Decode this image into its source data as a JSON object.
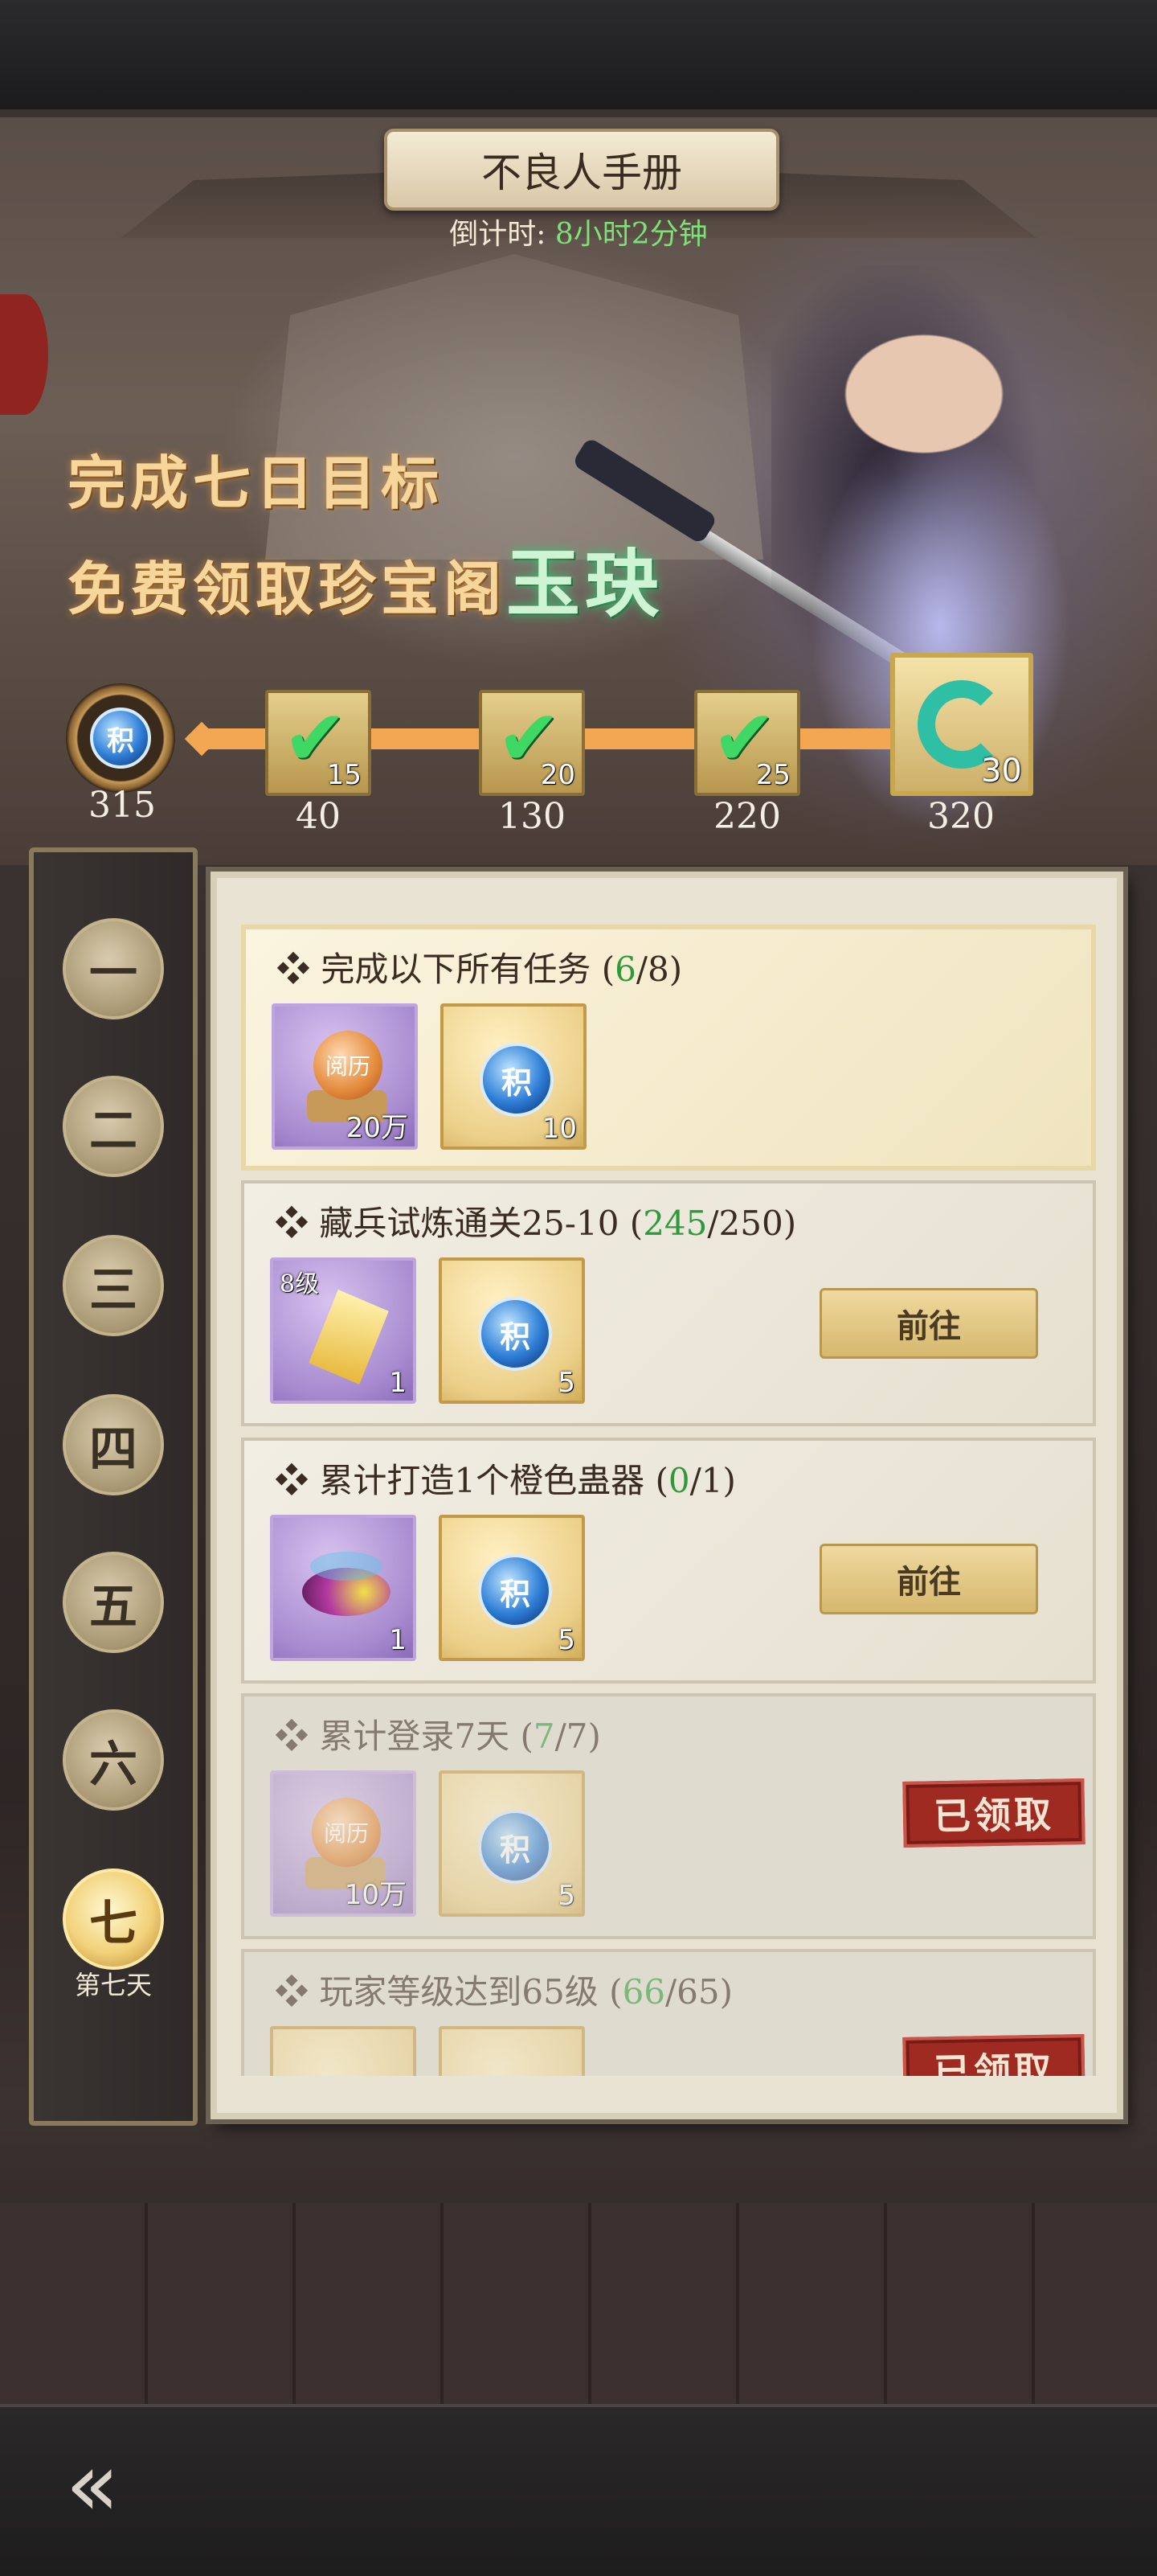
{
  "header": {
    "title": "不良人手册",
    "countdown_label": "倒计时: ",
    "countdown_value": "8小时2分钟"
  },
  "banner": {
    "line1": "完成七日目标",
    "line2_prefix": "免费领取珍宝阁",
    "line2_highlight": "玉玦"
  },
  "progress": {
    "current_points": "315",
    "point_icon_char": "积",
    "milestones": [
      {
        "label": "40",
        "count": "15",
        "claimed": true
      },
      {
        "label": "130",
        "count": "20",
        "claimed": true
      },
      {
        "label": "220",
        "count": "25",
        "claimed": true
      },
      {
        "label": "320",
        "count": "30",
        "claimed": false
      }
    ],
    "check_glyph": "✔"
  },
  "days": {
    "tabs": [
      "一",
      "二",
      "三",
      "四",
      "五",
      "六",
      "七"
    ],
    "active_index": 6,
    "active_caption": "第七天"
  },
  "tasks": [
    {
      "title": "完成以下所有任务",
      "progress_done": "6",
      "progress_total": "8",
      "rewards": [
        {
          "type": "yueli",
          "label": "阅历",
          "qty": "20万"
        },
        {
          "type": "points",
          "label": "积",
          "qty": "10"
        }
      ],
      "action": ""
    },
    {
      "title": "藏兵试炼通关25-10",
      "progress_done": "245",
      "progress_total": "250",
      "rewards": [
        {
          "type": "token",
          "level": "8级",
          "qty": "1"
        },
        {
          "type": "points",
          "label": "积",
          "qty": "5"
        }
      ],
      "action": "前往"
    },
    {
      "title": "累计打造1个橙色蛊器",
      "progress_done": "0",
      "progress_total": "1",
      "rewards": [
        {
          "type": "insect",
          "qty": "1"
        },
        {
          "type": "points",
          "label": "积",
          "qty": "5"
        }
      ],
      "action": "前往"
    },
    {
      "title": "累计登录7天",
      "progress_done": "7",
      "progress_total": "7",
      "rewards": [
        {
          "type": "yueli",
          "label": "阅历",
          "qty": "10万"
        },
        {
          "type": "points",
          "label": "积",
          "qty": "5"
        }
      ],
      "action": "已领取"
    },
    {
      "title": "玩家等级达到65级",
      "progress_done": "66",
      "progress_total": "65",
      "action": "已领取"
    }
  ],
  "nav": {
    "back_glyph": "«"
  }
}
